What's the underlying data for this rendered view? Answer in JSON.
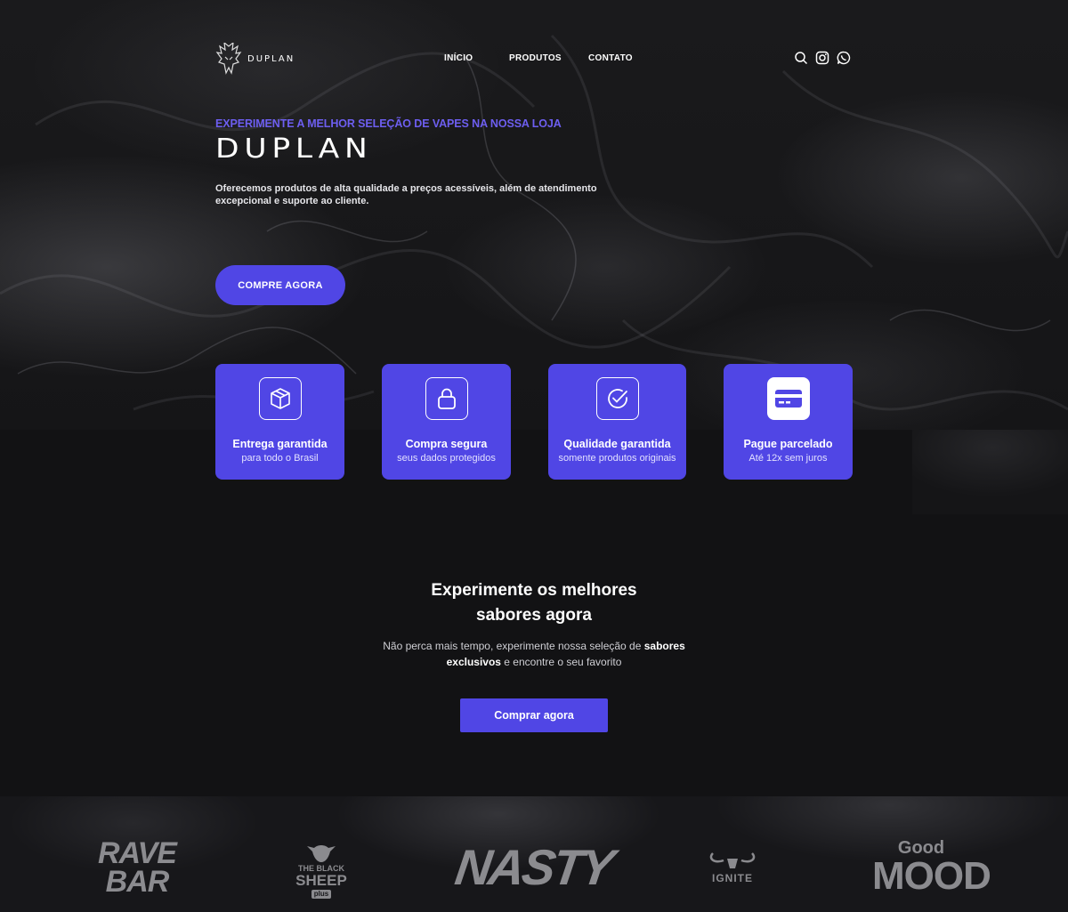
{
  "header": {
    "logo_text": "DUPLAN",
    "nav": [
      "INÍCIO",
      "PRODUTOS",
      "CONTATO"
    ],
    "icons": [
      "search-icon",
      "instagram-icon",
      "whatsapp-icon"
    ]
  },
  "hero": {
    "eyebrow": "EXPERIMENTE A MELHOR SELEÇÃO DE VAPES NA NOSSA LOJA",
    "title": "DUPLAN",
    "lead": "Oferecemos produtos de alta qualidade a preços acessíveis, além de atendimento excepcional e suporte ao cliente.",
    "cta": "COMPRE AGORA"
  },
  "features": [
    {
      "icon": "box-icon",
      "title": "Entrega garantida",
      "subtitle": "para todo o Brasil"
    },
    {
      "icon": "lock-icon",
      "title": "Compra segura",
      "subtitle": "seus dados protegidos"
    },
    {
      "icon": "check-circle-icon",
      "title": "Qualidade garantida",
      "subtitle": "somente produtos originais"
    },
    {
      "icon": "credit-card-icon",
      "title": "Pague parcelado",
      "subtitle": "Até 12x sem juros"
    }
  ],
  "flavors": {
    "title_line1": "Experimente os melhores",
    "title_line2": "sabores agora",
    "text_part1": "Não perca mais tempo, experimente nossa seleção de ",
    "text_bold": "sabores exclusivos",
    "text_part2": " e encontre o seu favorito",
    "cta": "Comprar agora"
  },
  "brands": {
    "rave_line1": "RAVE",
    "rave_line2": "BAR",
    "sheep_line1": "THE BLACK",
    "sheep_line2": "SHEEP",
    "sheep_line3": "plus",
    "nasty": "NASTY",
    "ignite": "IGNITE",
    "good_line1": "Good",
    "good_line2": "MOOD"
  },
  "colors": {
    "accent": "#5046e5",
    "eyebrow": "#6d5ef0",
    "background": "#121214"
  }
}
